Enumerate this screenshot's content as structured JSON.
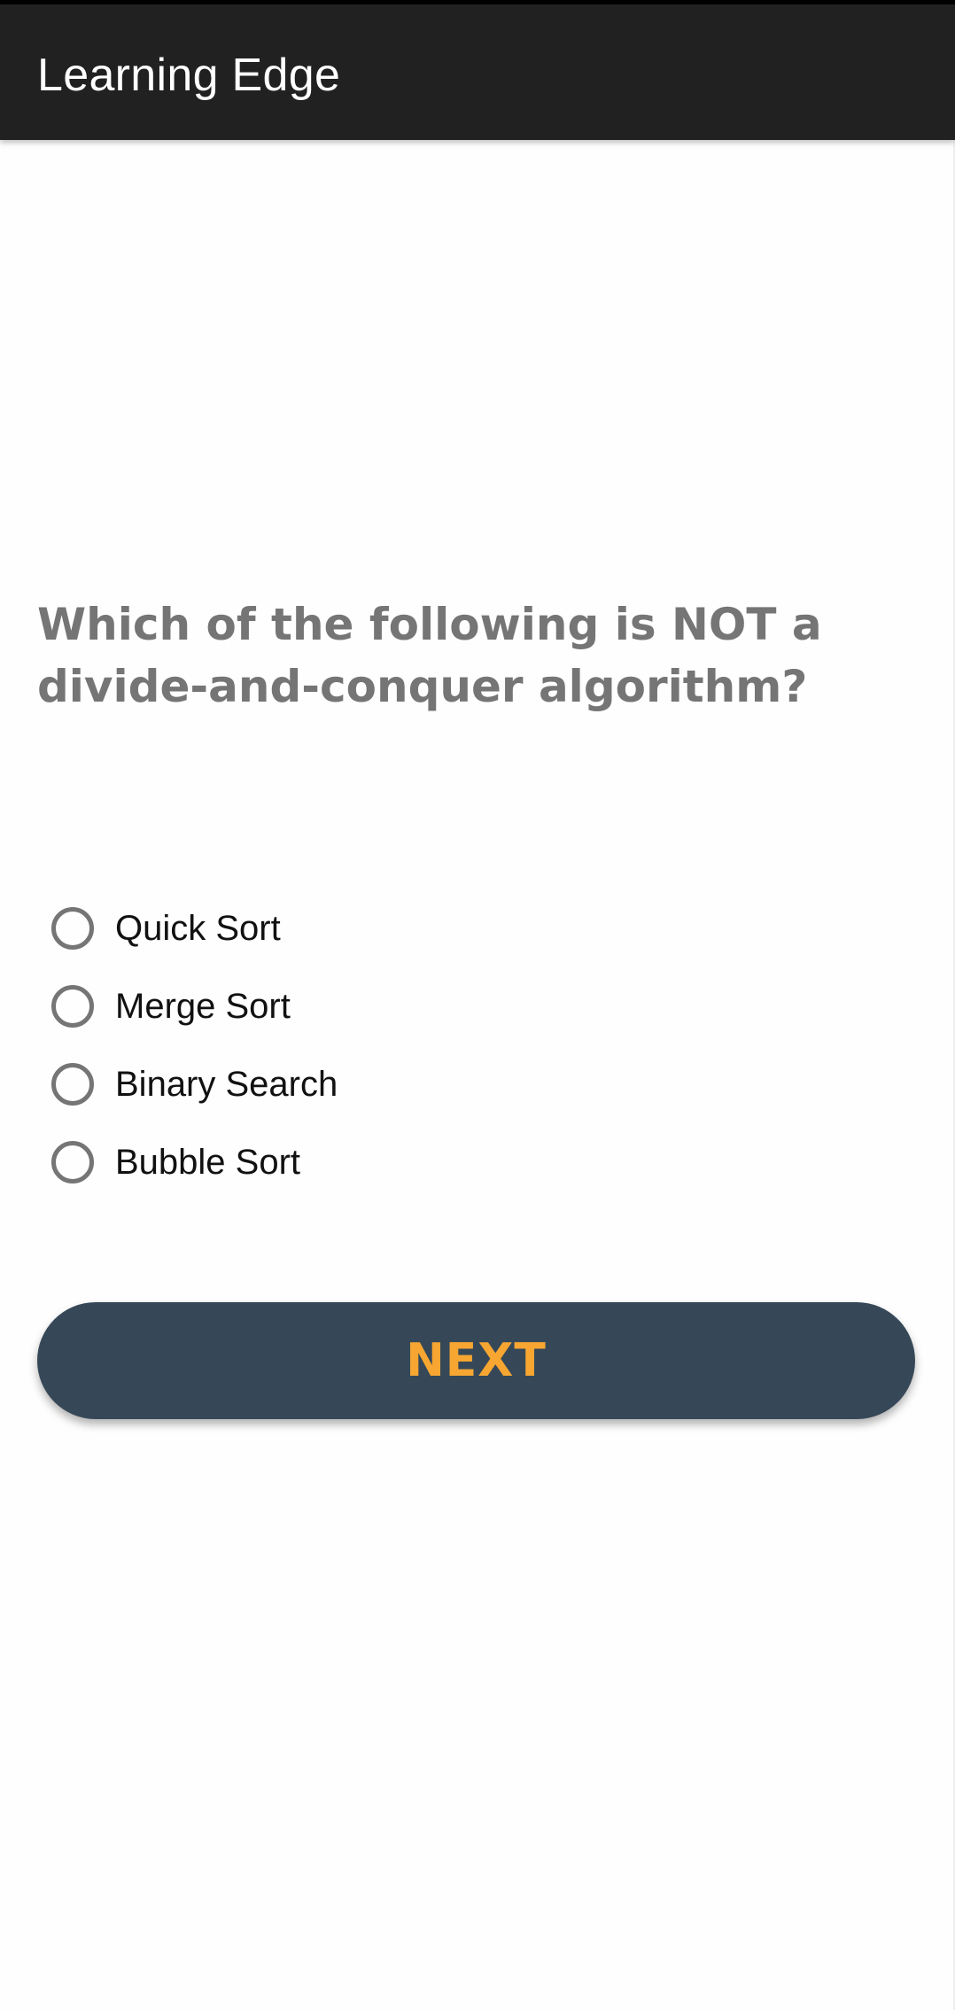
{
  "app_bar": {
    "title": "Learning Edge"
  },
  "quiz": {
    "question": "Which of the following is NOT a divide-and-conquer algorithm?",
    "options": [
      {
        "label": "Quick Sort",
        "selected": false
      },
      {
        "label": "Merge Sort",
        "selected": false
      },
      {
        "label": "Binary Search",
        "selected": false
      },
      {
        "label": "Bubble Sort",
        "selected": false
      }
    ],
    "next_label": "NEXT"
  },
  "colors": {
    "app_bar_bg": "#212121",
    "button_bg": "#364858",
    "button_text": "#f7a631",
    "question_text": "#757575",
    "radio_border": "#757575"
  }
}
